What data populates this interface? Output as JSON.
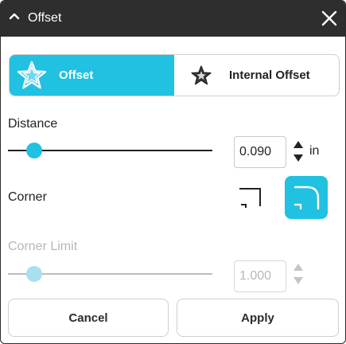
{
  "dialog": {
    "title": "Offset",
    "modes": [
      {
        "label": "Offset",
        "selected": true
      },
      {
        "label": "Internal Offset",
        "selected": false
      }
    ],
    "distance": {
      "label": "Distance",
      "value": "0.090",
      "unit": "in",
      "slider_fraction": 0.13
    },
    "corner": {
      "label": "Corner",
      "options": [
        {
          "style": "square",
          "selected": false
        },
        {
          "style": "rounded",
          "selected": true
        }
      ]
    },
    "corner_limit": {
      "label": "Corner Limit",
      "value": "1.000",
      "enabled": false,
      "slider_fraction": 0.13
    },
    "buttons": {
      "cancel": "Cancel",
      "apply": "Apply"
    }
  },
  "colors": {
    "accent": "#21c1e1",
    "titlebar": "#2e2e2e",
    "disabled": "#b7b7b7"
  },
  "icons": {
    "collapse": "chevron-up-icon",
    "close": "close-icon",
    "offset": "star-offset-icon",
    "internal_offset": "star-internal-offset-icon",
    "corner_square": "corner-square-icon",
    "corner_round": "corner-round-icon"
  }
}
